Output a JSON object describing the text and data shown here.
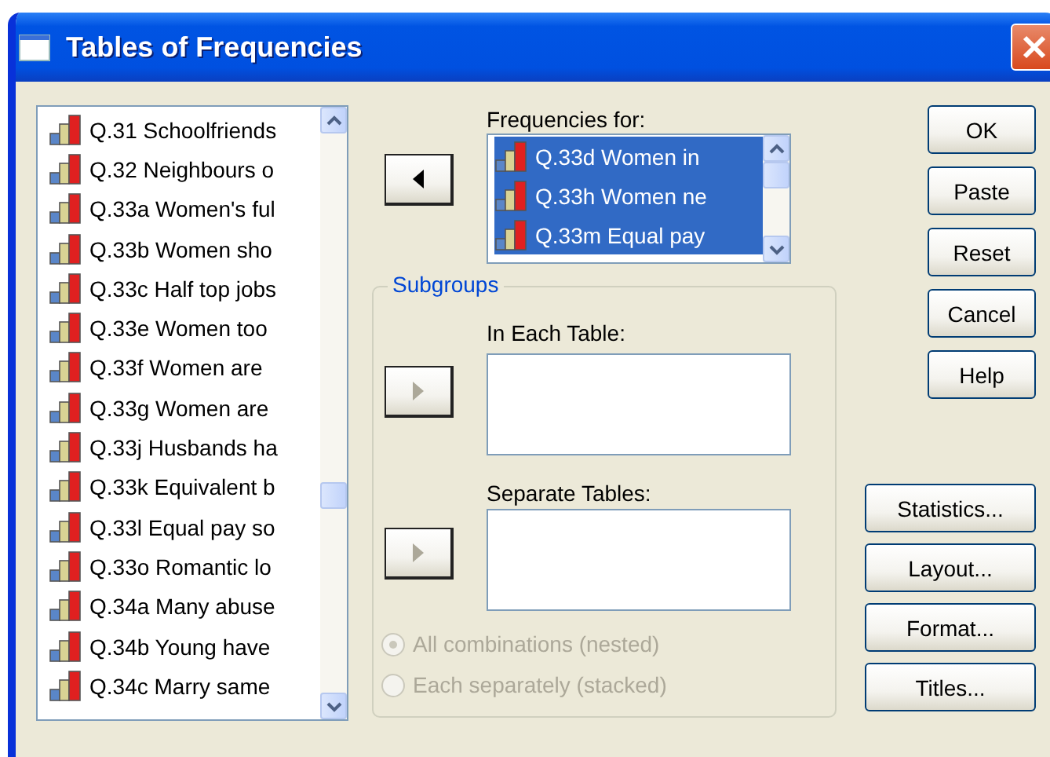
{
  "window": {
    "title": "Tables of Frequencies"
  },
  "variables": {
    "items": [
      {
        "label": "Q.31 Schoolfriends",
        "selected": false
      },
      {
        "label": "Q.32 Neighbours o",
        "selected": false
      },
      {
        "label": "Q.33a Women's ful",
        "selected": false
      },
      {
        "label": "Q.33b Women sho",
        "selected": false
      },
      {
        "label": "Q.33c Half top jobs",
        "selected": false
      },
      {
        "label": "Q.33e Women too",
        "selected": false
      },
      {
        "label": "Q.33f Women are",
        "selected": false
      },
      {
        "label": "Q.33g Women are",
        "selected": false
      },
      {
        "label": "Q.33j Husbands ha",
        "selected": false
      },
      {
        "label": "Q.33k Equivalent b",
        "selected": false
      },
      {
        "label": "Q.33l Equal pay so",
        "selected": false
      },
      {
        "label": "Q.33o Romantic lo",
        "selected": false
      },
      {
        "label": "Q.34a Many abuse",
        "selected": false
      },
      {
        "label": "Q.34b Young have",
        "selected": false
      },
      {
        "label": "Q.34c Marry same",
        "selected": false
      }
    ]
  },
  "frequencies_for": {
    "label": "Frequencies for:",
    "move_button": {
      "kind": "left",
      "disabled": false
    },
    "items": [
      {
        "label": "Q.33d Women in",
        "selected": true
      },
      {
        "label": "Q.33h Women ne",
        "selected": true
      },
      {
        "label": "Q.33m Equal pay",
        "selected": true
      }
    ]
  },
  "subgroups": {
    "title": "Subgroups",
    "in_each_table": {
      "label": "In Each Table:",
      "move_button": {
        "kind": "right",
        "disabled": true
      }
    },
    "separate_tables": {
      "label": "Separate Tables:",
      "move_button": {
        "kind": "right",
        "disabled": true
      }
    },
    "options": [
      {
        "label": "All combinations (nested)",
        "selected": true,
        "disabled": true
      },
      {
        "label": "Each separately (stacked)",
        "selected": false,
        "disabled": true
      }
    ]
  },
  "buttons": [
    "OK",
    "Paste",
    "Reset",
    "Cancel",
    "Help"
  ],
  "option_buttons": [
    "Statistics...",
    "Layout...",
    "Format...",
    "Titles..."
  ]
}
